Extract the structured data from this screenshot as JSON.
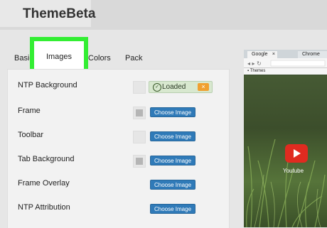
{
  "app": {
    "title": "ThemeBeta"
  },
  "tabs": [
    "Basic",
    "Images",
    "Colors",
    "Pack"
  ],
  "active_tab": "Images",
  "rows": [
    {
      "label": "NTP Background",
      "status": "Loaded",
      "remove_label": "×"
    },
    {
      "label": "Frame",
      "button": "Choose Image"
    },
    {
      "label": "Toolbar",
      "button": "Choose Image"
    },
    {
      "label": "Tab Background",
      "button": "Choose Image"
    },
    {
      "label": "Frame Overlay",
      "button": "Choose Image"
    },
    {
      "label": "NTP Attribution",
      "button": "Choose Image"
    }
  ],
  "preview": {
    "tab1": "Google",
    "tab1_close": "×",
    "tab2": "Chrome",
    "bookmark": "Themes",
    "shortcut_label": "Youtube"
  },
  "colors": {
    "highlight": "#33ee33",
    "button": "#2f7ab8",
    "loaded_bg": "#d8e8cf",
    "remove": "#f0a030"
  }
}
